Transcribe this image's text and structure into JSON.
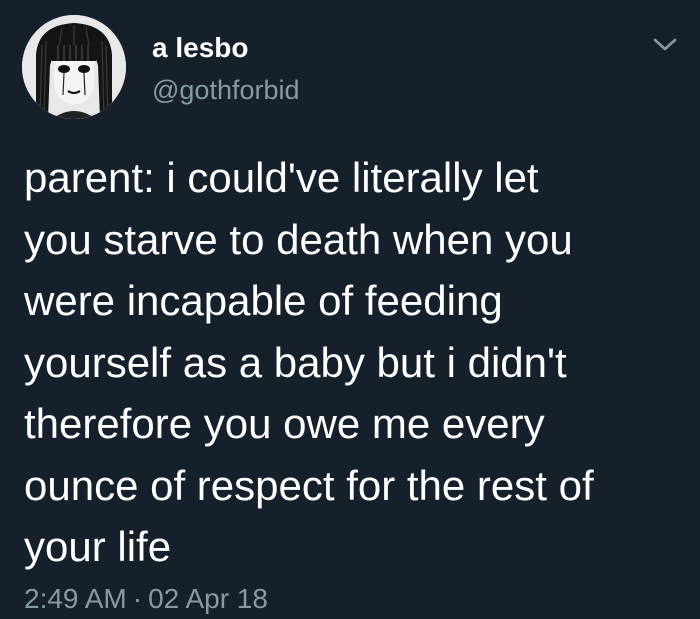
{
  "user": {
    "display_name": "a lesbo",
    "handle": "@gothforbid"
  },
  "tweet": {
    "lines": [
      "parent: i could've literally let",
      "you starve to death when you",
      "were incapable of feeding",
      "yourself as a baby but i didn't",
      "therefore you owe me every",
      "ounce of respect for the rest of",
      "your life"
    ]
  },
  "meta": {
    "time": "2:49 AM",
    "separator": "·",
    "date": "02 Apr 18"
  },
  "icons": {
    "menu": "chevron-down-icon",
    "avatar": "avatar-image"
  },
  "colors": {
    "background": "#15202b",
    "primary_text": "#ffffff",
    "secondary_text": "#8899a6"
  }
}
